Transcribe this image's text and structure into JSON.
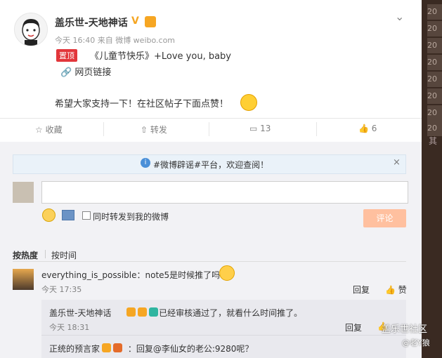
{
  "post": {
    "user_name": "盖乐世-天地神话",
    "verified_mark": "V",
    "meta": "今天 16:40 来自 微博 weibo.com",
    "pin_label": "置顶",
    "line1": "《儿童节快乐》+Love you, baby",
    "link_label": "网页链接",
    "body": "希望大家支持一下！在社区帖子下面点赞！",
    "menu_icon": "chevron-down-icon"
  },
  "actions": {
    "favorite": "收藏",
    "repost": "转发",
    "comments": "13",
    "likes": "6"
  },
  "notice": {
    "text": "#微博辟谣#平台，欢迎查阅！",
    "close": "×"
  },
  "composer": {
    "placeholder": "",
    "also_repost_label": "同时转发到我的微博",
    "submit_label": "评论"
  },
  "sort": {
    "by_hot": "按热度",
    "by_time": "按时间"
  },
  "comments": [
    {
      "user": "everything_is_possible",
      "text": "：note5是时候推了吗？",
      "time": "今天 17:35",
      "reply": "回复",
      "like": "赞"
    }
  ],
  "sub_comments": [
    {
      "user": "盖乐世-天地神话",
      "text": "：已经审核通过了，就看什么时间推了。",
      "time": "今天 18:31",
      "reply": "回复"
    },
    {
      "user": "正统的预言家",
      "text": "：回复@李仙女的老公:9280呢？"
    }
  ],
  "watermark": {
    "line1": "盖乐世社区",
    "line2": "@老Y狼"
  },
  "right_strip": {
    "items": [
      "20",
      "20",
      "20",
      "20",
      "20",
      "20",
      "20",
      "20"
    ],
    "caption": "其"
  }
}
